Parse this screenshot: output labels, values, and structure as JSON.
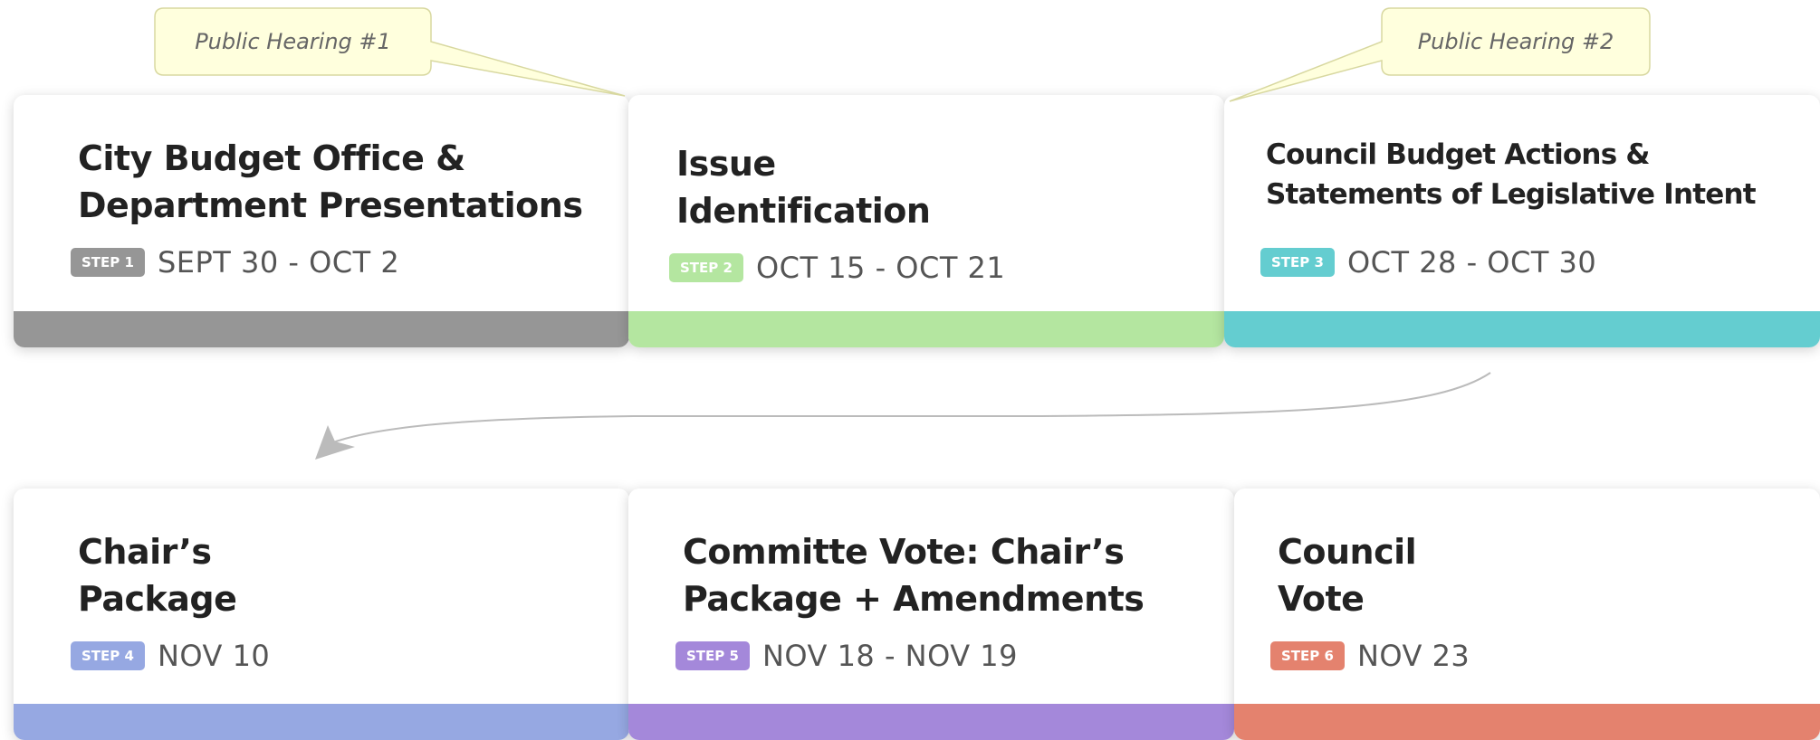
{
  "colors": {
    "step1": "#969696",
    "step2": "#b4e6a0",
    "step3": "#64cdd0",
    "step4": "#96a8e2",
    "step5": "#a488da",
    "step6": "#e4826e",
    "callout_fill": "#ffffdd",
    "callout_border": "#d8d8a0",
    "arrow": "#bbbbbb"
  },
  "callouts": [
    {
      "text": "Public Hearing #1"
    },
    {
      "text": "Public Hearing #2"
    }
  ],
  "steps": [
    {
      "title_lines": [
        "City Budget Office &",
        "Department Presentations"
      ],
      "badge": "STEP 1",
      "date": "SEPT 30  -  OCT 2"
    },
    {
      "title_lines": [
        "Issue",
        "Identification"
      ],
      "badge": "STEP 2",
      "date": "OCT 15  -  OCT 21"
    },
    {
      "title_lines": [
        "Council Budget Actions &",
        "Statements of Legislative Intent"
      ],
      "badge": "STEP 3",
      "date": "OCT 28  -  OCT 30"
    },
    {
      "title_lines": [
        "Chair’s",
        "Package"
      ],
      "badge": "STEP 4",
      "date": "NOV 10"
    },
    {
      "title_lines": [
        "Committe Vote: Chair’s",
        "Package + Amendments"
      ],
      "badge": "STEP 5",
      "date": "NOV 18  -  NOV 19"
    },
    {
      "title_lines": [
        "Council",
        "Vote"
      ],
      "badge": "STEP 6",
      "date": "NOV 23"
    }
  ]
}
